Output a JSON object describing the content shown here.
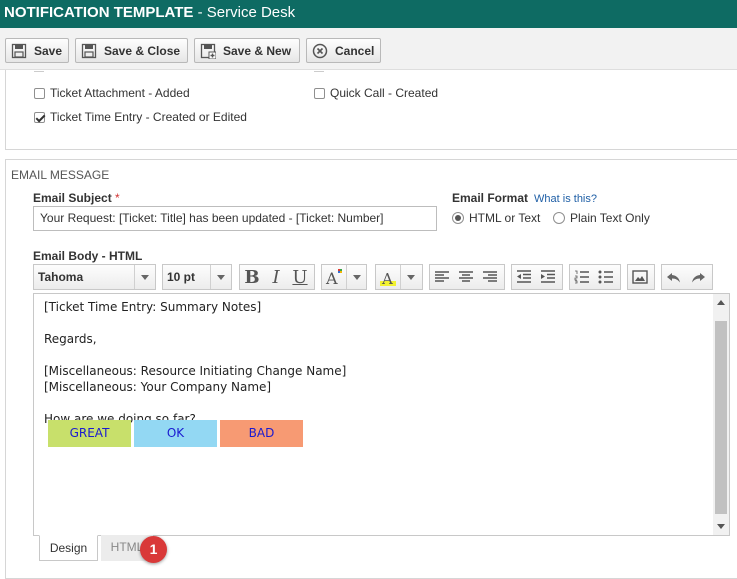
{
  "window": {
    "title": "NOTIFICATION TEMPLATE",
    "subtitle": " - Service Desk"
  },
  "toolbar": {
    "save": "Save",
    "save_close": "Save & Close",
    "save_new": "Save & New",
    "cancel": "Cancel"
  },
  "events": {
    "ticket_attachment": {
      "label": "Ticket Attachment - Added",
      "checked": false
    },
    "quick_call": {
      "label": "Quick Call - Created",
      "checked": false
    },
    "ticket_time_entry": {
      "label": "Ticket Time Entry - Created or Edited",
      "checked": true
    }
  },
  "email": {
    "section_title": "EMAIL MESSAGE",
    "subject_label": "Email Subject",
    "required_marker": "*",
    "subject_value": "Your Request: [Ticket: Title] has been updated - [Ticket: Number]",
    "format_label": "Email Format",
    "format_help": "What is this?",
    "format_options": [
      "HTML or Text",
      "Plain Text Only"
    ],
    "format_selected": "HTML or Text",
    "body_label": "Email Body - HTML"
  },
  "editor_toolbar": {
    "font": "Tahoma",
    "size": "10 pt"
  },
  "body": {
    "lines": [
      "[Ticket Time Entry: Summary Notes]",
      "",
      "Regards,",
      "",
      "[Miscellaneous: Resource Initiating Change Name]",
      "[Miscellaneous: Your Company Name]",
      "",
      "How are we doing so far?"
    ],
    "buttons": [
      {
        "label": "GREAT",
        "color": "#c8e06b"
      },
      {
        "label": "OK",
        "color": "#93d8f3"
      },
      {
        "label": "BAD",
        "color": "#f79a73"
      }
    ]
  },
  "tabs": {
    "design": "Design",
    "html": "HTML"
  },
  "badge": "1",
  "colors": {
    "header": "#0e6b63",
    "link": "#1f5fa6",
    "required": "#d13333",
    "badge": "#d93939"
  }
}
